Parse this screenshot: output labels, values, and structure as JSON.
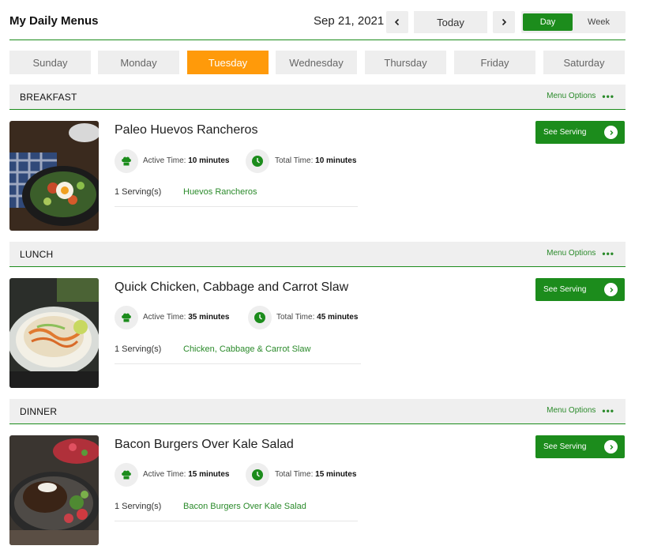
{
  "header": {
    "title": "My Daily Menus",
    "date": "Sep 21, 2021",
    "today_label": "Today",
    "view_day": "Day",
    "view_week": "Week"
  },
  "days": [
    "Sunday",
    "Monday",
    "Tuesday",
    "Wednesday",
    "Thursday",
    "Friday",
    "Saturday"
  ],
  "active_day": "Tuesday",
  "menu_options_label": "Menu Options",
  "see_serving_label": "See Serving",
  "active_time_label": "Active Time:",
  "total_time_label": "Total Time:",
  "meals": [
    {
      "section": "BREAKFAST",
      "name": "Paleo Huevos Rancheros",
      "active_time": "10 minutes",
      "total_time": "10 minutes",
      "servings": "1 Serving(s)",
      "recipe": "Huevos Rancheros"
    },
    {
      "section": "LUNCH",
      "name": "Quick Chicken, Cabbage and Carrot Slaw",
      "active_time": "35 minutes",
      "total_time": "45 minutes",
      "servings": "1 Serving(s)",
      "recipe": "Chicken, Cabbage & Carrot Slaw"
    },
    {
      "section": "DINNER",
      "name": "Bacon Burgers Over Kale Salad",
      "active_time": "15 minutes",
      "total_time": "15 minutes",
      "servings": "1 Serving(s)",
      "recipe": "Bacon Burgers Over Kale Salad"
    }
  ],
  "colors": {
    "accent_green": "#1c8c1c",
    "active_tab_orange": "#ff9a0a",
    "bar_gray": "#efefef"
  },
  "icons": [
    "chevron-left-icon",
    "chevron-right-icon",
    "chef-hat-icon",
    "clock-icon",
    "more-dots-icon"
  ]
}
